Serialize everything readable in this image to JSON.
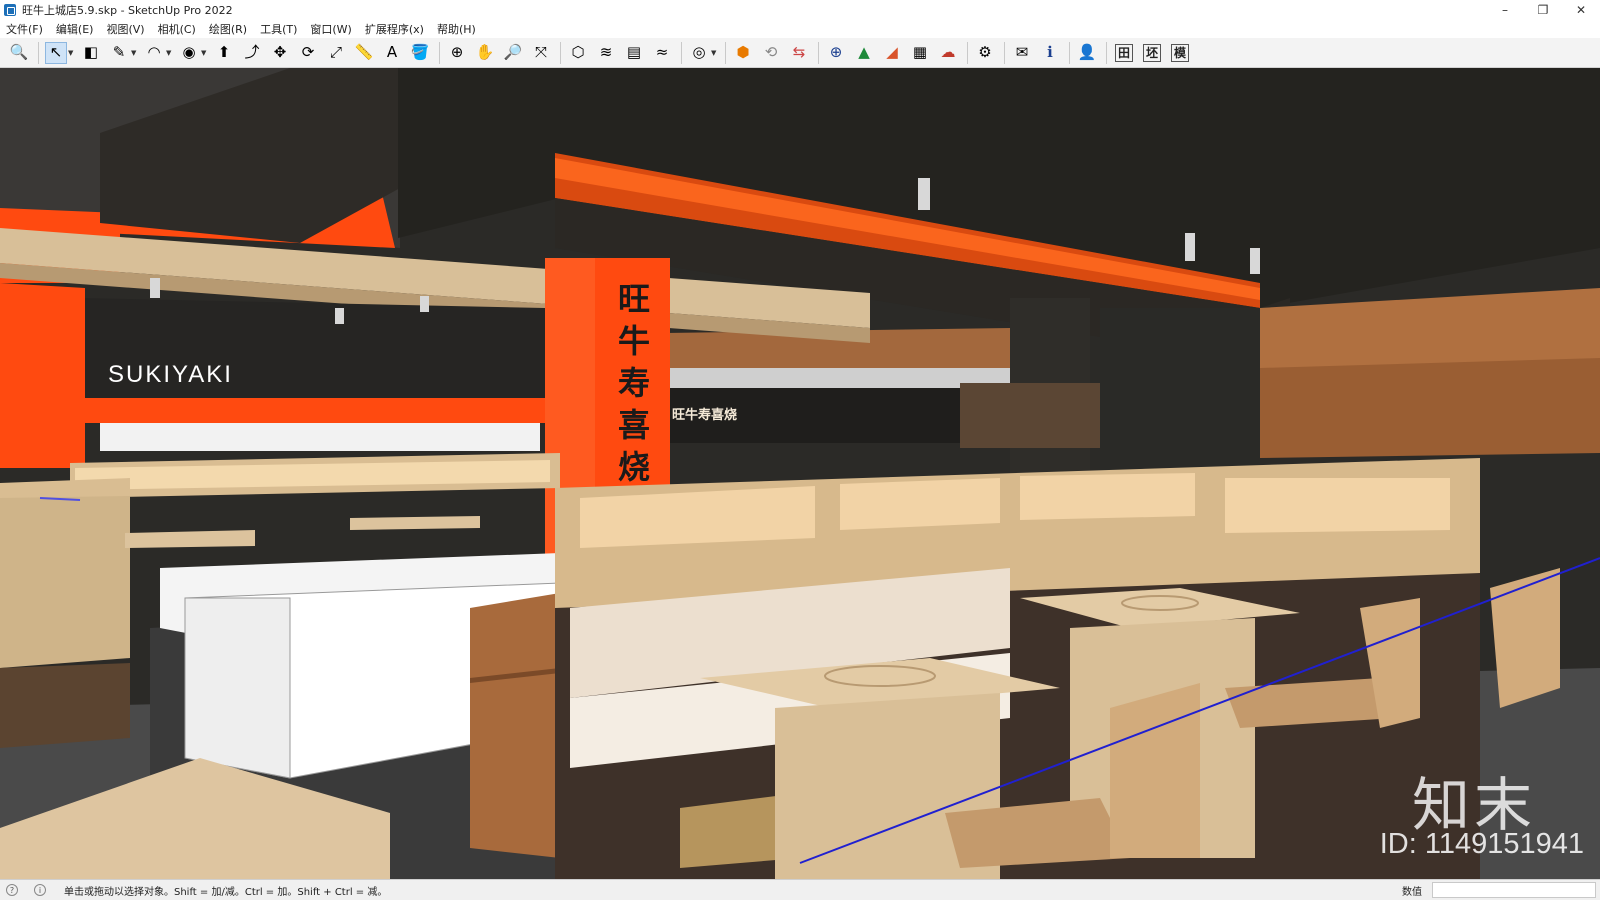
{
  "window": {
    "title": "旺牛上城店5.9.skp - SketchUp Pro 2022",
    "controls": {
      "minimize": "–",
      "restore": "❐",
      "close": "✕"
    }
  },
  "menu": [
    "文件(F)",
    "编辑(E)",
    "视图(V)",
    "相机(C)",
    "绘图(R)",
    "工具(T)",
    "窗口(W)",
    "扩展程序(x)",
    "帮助(H)"
  ],
  "toolbar": {
    "tools": [
      {
        "name": "zoom-icon",
        "glyph": "🔍"
      },
      {
        "name": "select-icon",
        "glyph": "↖"
      },
      {
        "name": "eraser-icon",
        "glyph": "◧"
      },
      {
        "name": "pencil-icon",
        "glyph": "✎"
      },
      {
        "name": "arc-icon",
        "glyph": "◠"
      },
      {
        "name": "shape-icon",
        "glyph": "◉"
      },
      {
        "name": "push-pull-icon",
        "glyph": "⬆"
      },
      {
        "name": "follow-me-icon",
        "glyph": "⤴"
      },
      {
        "name": "move-icon",
        "glyph": "✥"
      },
      {
        "name": "rotate-icon",
        "glyph": "⟳"
      },
      {
        "name": "scale-icon",
        "glyph": "⤢"
      },
      {
        "name": "tape-measure-icon",
        "glyph": "📏"
      },
      {
        "name": "text-icon",
        "glyph": "A"
      },
      {
        "name": "paint-bucket-icon",
        "glyph": "🪣"
      },
      {
        "name": "orbit-icon",
        "glyph": "⊕"
      },
      {
        "name": "pan-icon",
        "glyph": "✋"
      },
      {
        "name": "zoom-window-icon",
        "glyph": "🔎"
      },
      {
        "name": "zoom-extents-icon",
        "glyph": "⤧"
      },
      {
        "name": "section-plane-icon",
        "glyph": "⬡"
      },
      {
        "name": "sandbox-icon",
        "glyph": "≋"
      },
      {
        "name": "layers-icon",
        "glyph": "▤"
      },
      {
        "name": "terrain-icon",
        "glyph": "≈"
      },
      {
        "name": "user-circle-icon",
        "glyph": "◎"
      },
      {
        "name": "warehouse-icon",
        "glyph": "⬢"
      },
      {
        "name": "sync-icon",
        "glyph": "⟲"
      },
      {
        "name": "export-icon",
        "glyph": "⇆"
      },
      {
        "name": "add-icon",
        "glyph": "⊕"
      },
      {
        "name": "tree-icon",
        "glyph": "▲"
      },
      {
        "name": "stairs-icon",
        "glyph": "◢"
      },
      {
        "name": "checker-icon",
        "glyph": "▦"
      },
      {
        "name": "cloud-upload-icon",
        "glyph": "☁"
      },
      {
        "name": "gear-icon",
        "glyph": "⚙"
      },
      {
        "name": "mail-icon",
        "glyph": "✉"
      },
      {
        "name": "info-icon",
        "glyph": "ℹ"
      },
      {
        "name": "user-icon",
        "glyph": "👤"
      }
    ],
    "text_buttons": [
      "田",
      "坯",
      "模"
    ]
  },
  "scene": {
    "sign_main": "SUKIYAKI",
    "sign_vertical": "旺牛寿喜烧",
    "sign_small": "旺牛寿喜烧",
    "watermark_brand": "知末",
    "watermark_id": "ID: 1149151941"
  },
  "status": {
    "hint": "单击或拖动以选择对象。Shift = 加/减。Ctrl = 加。Shift + Ctrl = 减。",
    "measurements_label": "数值",
    "measurements_value": ""
  }
}
